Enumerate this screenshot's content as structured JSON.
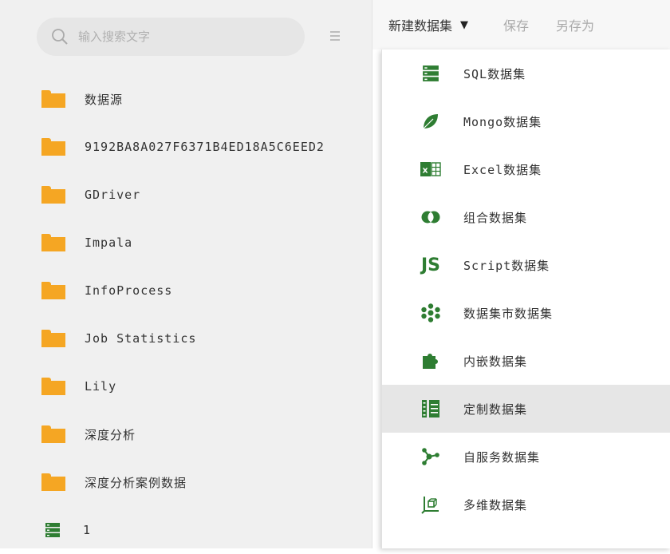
{
  "search": {
    "placeholder": "输入搜索文字",
    "value": ""
  },
  "tree": {
    "items": [
      {
        "label": "数据源",
        "icon": "folder-icon"
      },
      {
        "label": "9192BA8A027F6371B4ED18A5C6EED2",
        "icon": "folder-icon"
      },
      {
        "label": "GDriver",
        "icon": "folder-icon"
      },
      {
        "label": "Impala",
        "icon": "folder-icon"
      },
      {
        "label": "InfoProcess",
        "icon": "folder-icon"
      },
      {
        "label": "Job Statistics",
        "icon": "folder-icon"
      },
      {
        "label": "Lily",
        "icon": "folder-icon"
      },
      {
        "label": "深度分析",
        "icon": "folder-icon"
      },
      {
        "label": "深度分析案例数据",
        "icon": "folder-icon"
      },
      {
        "label": "1",
        "icon": "sql-dataset-icon"
      }
    ]
  },
  "toolbar": {
    "new_label": "新建数据集",
    "save_label": "保存",
    "save_as_label": "另存为"
  },
  "dropdown": {
    "items": [
      {
        "label": "SQL数据集",
        "icon": "sql-dataset-icon"
      },
      {
        "label": "Mongo数据集",
        "icon": "mongo-leaf-icon"
      },
      {
        "label": "Excel数据集",
        "icon": "excel-icon"
      },
      {
        "label": "组合数据集",
        "icon": "combine-circles-icon"
      },
      {
        "label": "Script数据集",
        "icon": "js-icon",
        "icon_text": "JS"
      },
      {
        "label": "数据集市数据集",
        "icon": "datamart-icon"
      },
      {
        "label": "内嵌数据集",
        "icon": "puzzle-icon"
      },
      {
        "label": "定制数据集",
        "icon": "custom-dataset-icon"
      },
      {
        "label": "自服务数据集",
        "icon": "self-service-icon"
      },
      {
        "label": "多维数据集",
        "icon": "multidimensional-icon"
      }
    ],
    "hovered_index": 7
  },
  "colors": {
    "accent_green": "#2e7d32",
    "folder": "#f5a623"
  }
}
